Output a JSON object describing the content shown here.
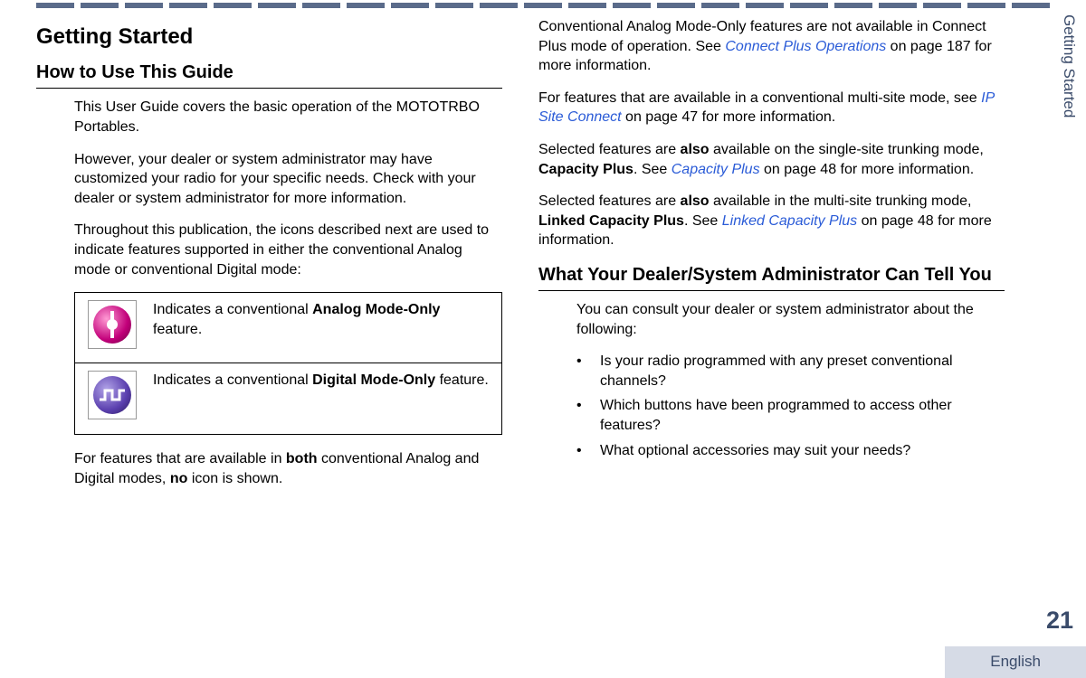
{
  "dashes": 12,
  "side_tab": "Getting Started",
  "page_number": "21",
  "language": "English",
  "col1": {
    "h1": "Getting Started",
    "h2": "How to Use This Guide",
    "p1": "This User Guide covers the basic operation of the MOTOTRBO Portables.",
    "p2": "However, your dealer or system administrator may have customized your radio for your specific needs. Check with your dealer or system administrator for more information.",
    "p3": "Throughout this publication, the icons described next are used to indicate features supported in either the conventional Analog mode or conventional Digital mode:",
    "analog_pre": "Indicates a conventional ",
    "analog_bold": "Analog Mode-Only",
    "analog_post": " feature.",
    "digital_pre": "Indicates a conventional ",
    "digital_bold": "Digital Mode-Only",
    "digital_post": " feature.",
    "p4_a": "For features that are available in ",
    "p4_b": "both",
    "p4_c": " conventional Analog and Digital modes, ",
    "p4_d": "no",
    "p4_e": " icon is shown."
  },
  "col2": {
    "p1_a": "Conventional Analog Mode-Only features are not available in Connect Plus mode of operation. See ",
    "p1_link": "Connect Plus Operations",
    "p1_b": " on page 187 for more information.",
    "p2_a": "For features that are available in a conventional multi-site mode, see ",
    "p2_link": "IP Site Connect",
    "p2_b": " on page 47 for more information.",
    "p3_a": "Selected features are ",
    "p3_b": "also",
    "p3_c": " available on the single-site trunking mode, ",
    "p3_d": "Capacity Plus",
    "p3_e": ". See ",
    "p3_link": "Capacity Plus",
    "p3_f": " on page 48 for more information.",
    "p4_a": "Selected features are ",
    "p4_b": "also",
    "p4_c": " available in the multi-site trunking mode, ",
    "p4_d": "Linked Capacity Plus",
    "p4_e": ". See ",
    "p4_link": "Linked Capacity Plus",
    "p4_f": " on page 48 for more information.",
    "h2": "What Your Dealer/System Administrator Can Tell You",
    "p5": "You can consult your dealer or system administrator about the following:",
    "bullets": {
      "b1": "Is your radio programmed with any preset conventional channels?",
      "b2": "Which buttons have been programmed to access other features?",
      "b3": "What optional accessories may suit your needs?"
    }
  }
}
